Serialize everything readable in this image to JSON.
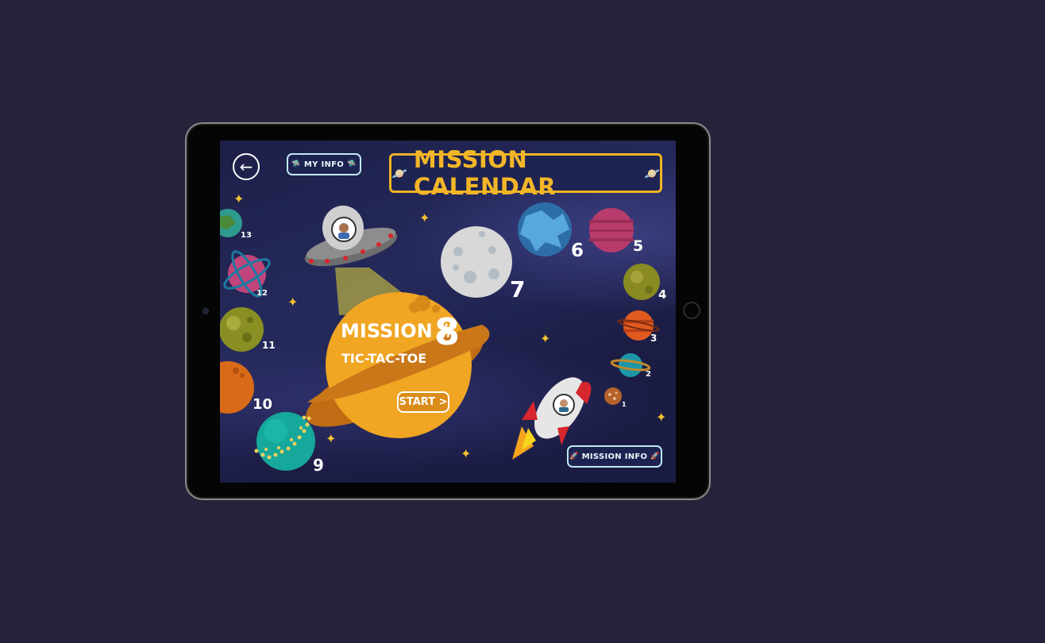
{
  "header": {
    "back_icon": "arrow-left-icon",
    "my_info_label": "MY INFO",
    "title": "MISSION CALENDAR"
  },
  "current_mission": {
    "label": "MISSION #",
    "number": "8",
    "name": "TIC-TAC-TOE",
    "start_label": "START >"
  },
  "mission_info_label": "MISSION INFO",
  "planets": [
    {
      "number": "1"
    },
    {
      "number": "2"
    },
    {
      "number": "3"
    },
    {
      "number": "4"
    },
    {
      "number": "5"
    },
    {
      "number": "6"
    },
    {
      "number": "7"
    },
    {
      "number": "9"
    },
    {
      "number": "10"
    },
    {
      "number": "11"
    },
    {
      "number": "12"
    },
    {
      "number": "13"
    }
  ],
  "colors": {
    "background": "#262239",
    "accent": "#f2b628",
    "pill_border": "#bfe9f0"
  }
}
